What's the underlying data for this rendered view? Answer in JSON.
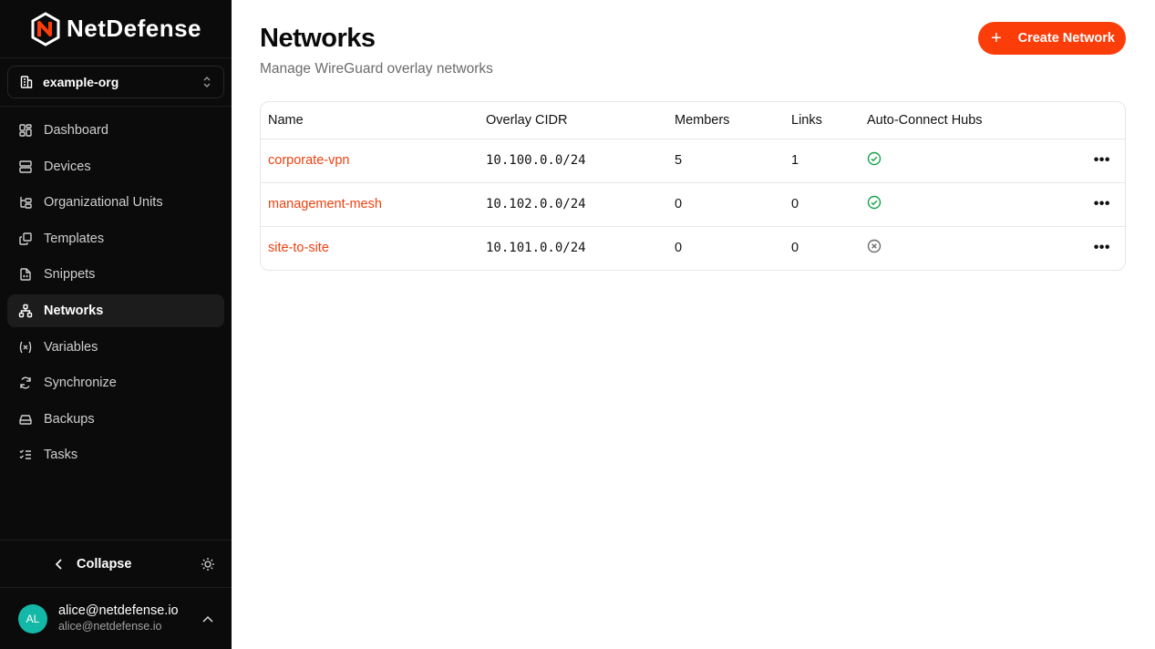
{
  "brand": {
    "name": "NetDefense",
    "accent": "#fb3d0a"
  },
  "org": {
    "name": "example-org"
  },
  "nav": [
    {
      "label": "Dashboard",
      "icon": "dashboard-icon",
      "active": false
    },
    {
      "label": "Devices",
      "icon": "server-icon",
      "active": false
    },
    {
      "label": "Organizational Units",
      "icon": "tree-icon",
      "active": false
    },
    {
      "label": "Templates",
      "icon": "copy-icon",
      "active": false
    },
    {
      "label": "Snippets",
      "icon": "file-code-icon",
      "active": false
    },
    {
      "label": "Networks",
      "icon": "network-icon",
      "active": true
    },
    {
      "label": "Variables",
      "icon": "variable-icon",
      "active": false
    },
    {
      "label": "Synchronize",
      "icon": "refresh-icon",
      "active": false
    },
    {
      "label": "Backups",
      "icon": "hard-drive-icon",
      "active": false
    },
    {
      "label": "Tasks",
      "icon": "list-checks-icon",
      "active": false
    }
  ],
  "footer": {
    "collapse_label": "Collapse"
  },
  "user": {
    "initials": "AL",
    "name": "alice@netdefense.io",
    "email": "alice@netdefense.io"
  },
  "page": {
    "title": "Networks",
    "subtitle": "Manage WireGuard overlay networks",
    "create_label": "Create Network"
  },
  "table": {
    "headers": {
      "name": "Name",
      "cidr": "Overlay CIDR",
      "members": "Members",
      "links": "Links",
      "hubs": "Auto-Connect Hubs"
    },
    "rows": [
      {
        "name": "corporate-vpn",
        "cidr": "10.100.0.0/24",
        "members": "5",
        "links": "1",
        "auto_connect": true
      },
      {
        "name": "management-mesh",
        "cidr": "10.102.0.0/24",
        "members": "0",
        "links": "0",
        "auto_connect": true
      },
      {
        "name": "site-to-site",
        "cidr": "10.101.0.0/24",
        "members": "0",
        "links": "0",
        "auto_connect": false
      }
    ],
    "actions_glyph": "•••"
  }
}
